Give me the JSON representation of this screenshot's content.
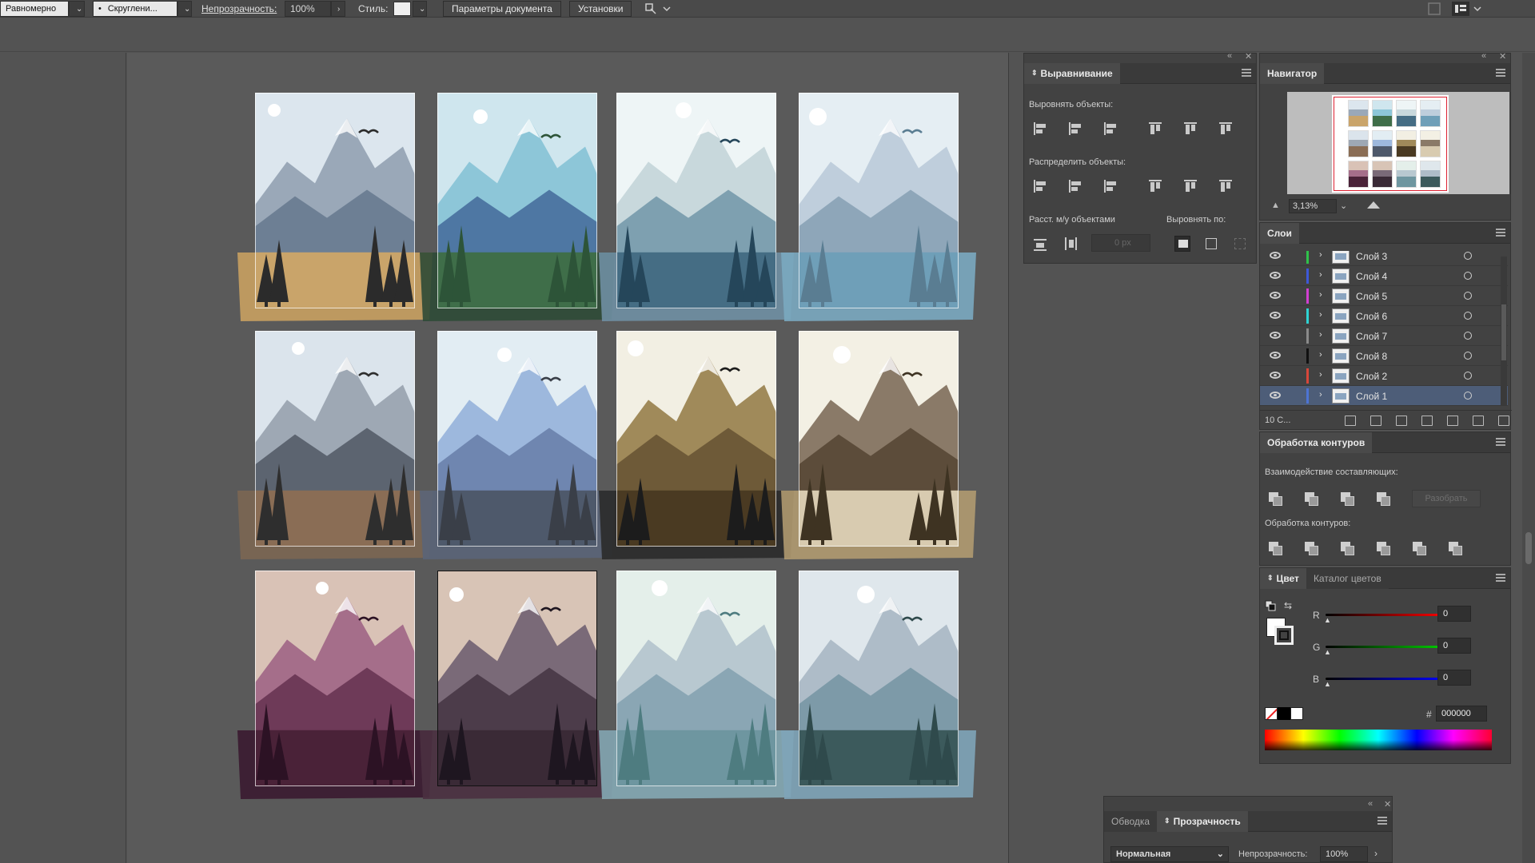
{
  "toolbar": {
    "stroke_profile": "Равномерно",
    "brush": "Скруглени...",
    "opacity_label": "Непрозрачность:",
    "opacity_value": "100%",
    "style_label": "Стиль:",
    "doc_settings": "Параметры документа",
    "preferences": "Установки"
  },
  "align_panel": {
    "tab": "Выравнивание",
    "align_objects": "Выровнять объекты:",
    "distribute_objects": "Распределить объекты:",
    "distribute_spacing": "Расст. м/у объектами",
    "align_to": "Выровнять по:",
    "spacing_placeholder": "0 px"
  },
  "navigator": {
    "tab": "Навигатор",
    "zoom": "3,13%"
  },
  "layers": {
    "tab": "Слои",
    "count": "10 С...",
    "items": [
      {
        "name": "Слой 3",
        "color": "#2fc24a"
      },
      {
        "name": "Слой 4",
        "color": "#3d58d8"
      },
      {
        "name": "Слой 5",
        "color": "#d23fd2"
      },
      {
        "name": "Слой 6",
        "color": "#2ed4d4"
      },
      {
        "name": "Слой 7",
        "color": "#8a8a8a"
      },
      {
        "name": "Слой 8",
        "color": "#111111"
      },
      {
        "name": "Слой 2",
        "color": "#d8473a"
      },
      {
        "name": "Слой 1",
        "color": "#4d74d4"
      }
    ]
  },
  "pathfinder": {
    "tab": "Обработка контуров",
    "shape_modes": "Взаимодействие составляющих:",
    "expand": "Разобрать",
    "pathfinders": "Обработка контуров:"
  },
  "color": {
    "tab": "Цвет",
    "tab2": "Каталог цветов",
    "r_label": "R",
    "g_label": "G",
    "b_label": "B",
    "r_value": "0",
    "g_value": "0",
    "b_value": "0",
    "hash": "#",
    "hex": "000000"
  },
  "transparency": {
    "tab1": "Обводка",
    "tab2": "Прозрачность",
    "blend_mode": "Нормальная",
    "opacity_label": "Непрозрачность:",
    "opacity_value": "100%"
  },
  "artboards": [
    {
      "name": "artboard-1",
      "sky": "#dce6ee",
      "far": "#9aa8b8",
      "mid": "#6d7f94",
      "ground": "#c9a46a",
      "tree": "#2b2b2b",
      "sun": "#ffffff",
      "bleed": "#c8a060"
    },
    {
      "name": "artboard-2",
      "sky": "#cfe6ee",
      "far": "#8dc6d8",
      "mid": "#4e77a3",
      "ground": "#3f6e49",
      "tree": "#2d5438",
      "sun": "#ffffff",
      "bleed": "#2e4a36"
    },
    {
      "name": "artboard-3",
      "sky": "#eef5f6",
      "far": "#c8d8dc",
      "mid": "#7ea0b0",
      "ground": "#456d84",
      "tree": "#25465a",
      "sun": "#ffffff",
      "bleed": "#6f8fa3"
    },
    {
      "name": "artboard-4",
      "sky": "#e5eef3",
      "far": "#bfcedc",
      "mid": "#8ea6b9",
      "ground": "#6f9fb8",
      "tree": "#5a7d92",
      "sun": "#ffffff",
      "bleed": "#7aa8c0"
    },
    {
      "name": "artboard-5",
      "sky": "#dbe4ec",
      "far": "#9ea8b4",
      "mid": "#5c6470",
      "ground": "#8a6d55",
      "tree": "#2e2e2e",
      "sun": "#ffffff",
      "bleed": "#7b6652"
    },
    {
      "name": "artboard-6",
      "sky": "#e2edf3",
      "far": "#9db8dd",
      "mid": "#6f86b0",
      "ground": "#4e596b",
      "tree": "#3a3f48",
      "sun": "#ffffff",
      "bleed": "#5a6478"
    },
    {
      "name": "artboard-7",
      "sky": "#f2efe3",
      "far": "#a08a5a",
      "mid": "#6e5a38",
      "ground": "#4a3a22",
      "tree": "#1c1c1c",
      "sun": "#ffffff",
      "bleed": "#2a2a2a"
    },
    {
      "name": "artboard-8",
      "sky": "#f3f0e4",
      "far": "#8a7a68",
      "mid": "#5c4c3a",
      "ground": "#d8cbb0",
      "tree": "#3e3322",
      "sun": "#ffffff",
      "bleed": "#b09a70"
    },
    {
      "name": "artboard-9",
      "sky": "#d9c2b6",
      "far": "#a56e8a",
      "mid": "#6e3a58",
      "ground": "#4a2238",
      "tree": "#2c1224",
      "sun": "#ffffff",
      "bleed": "#3a1a30"
    },
    {
      "name": "artboard-10",
      "sky": "#d8c4b6",
      "far": "#7a6a78",
      "mid": "#4c3c4a",
      "ground": "#3a2a36",
      "tree": "#1e1620",
      "sun": "#ffffff",
      "bleed": "#4a3040"
    },
    {
      "name": "artboard-11",
      "sky": "#e4efea",
      "far": "#b8c8d0",
      "mid": "#8aa6b4",
      "ground": "#6e96a0",
      "tree": "#4e7c80",
      "sun": "#ffffff",
      "bleed": "#84a8b4"
    },
    {
      "name": "artboard-12",
      "sky": "#dfe7ec",
      "far": "#aebcc8",
      "mid": "#7d9aa8",
      "ground": "#3c5a5c",
      "tree": "#2f4a4c",
      "sun": "#ffffff",
      "bleed": "#7ea4b8"
    }
  ]
}
